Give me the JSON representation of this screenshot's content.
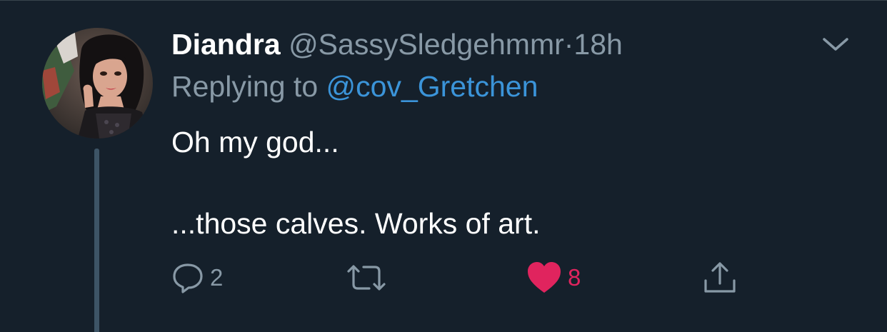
{
  "tweet": {
    "author_name": "Diandra",
    "handle": "@SassySledgehmmr",
    "separator": "·",
    "time": "18h",
    "replying_prefix": "Replying to",
    "replying_handle": "@cov_Gretchen",
    "body_line1": "Oh my god...",
    "body_line2": "...those calves. Works of art."
  },
  "actions": {
    "reply": {
      "icon": "reply-icon",
      "count": "2"
    },
    "retweet": {
      "icon": "retweet-icon",
      "count": ""
    },
    "like": {
      "icon": "heart-icon",
      "count": "8",
      "liked": true
    },
    "share": {
      "icon": "share-icon"
    }
  },
  "colors": {
    "background": "#15202b",
    "text_primary": "#ffffff",
    "text_secondary": "#8899a6",
    "link": "#3b94d9",
    "like": "#e0245e",
    "thread_line": "#3d5466"
  }
}
